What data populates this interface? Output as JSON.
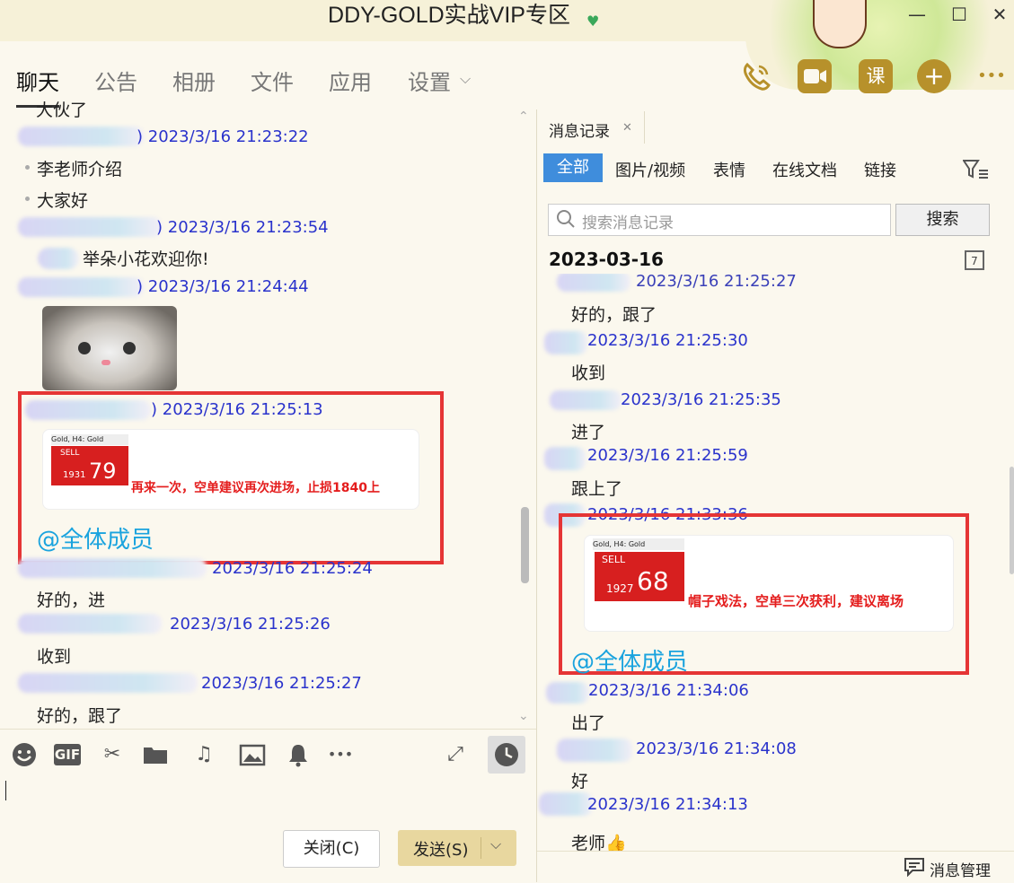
{
  "window": {
    "title": "DDY-GOLD实战VIP专区",
    "heart_glyph": "♥",
    "minimize_glyph": "—",
    "maximize_glyph": "☐",
    "close_glyph": "✕"
  },
  "nav": {
    "tabs": [
      "聊天",
      "公告",
      "相册",
      "文件",
      "应用",
      "设置"
    ],
    "settings_chevron": "⌵",
    "toolbar_icons": [
      "phone-icon",
      "video-icon",
      "course-icon",
      "add-icon",
      "more-icon"
    ],
    "course_label": "课",
    "add_label": "+",
    "more_label": "•••"
  },
  "chat": {
    "top_fragment": "大伙了",
    "messages": [
      {
        "time": "2023/3/16 21:23:22",
        "bullets": [
          "李老师介绍",
          "大家好"
        ]
      },
      {
        "time": "2023/3/16 21:23:54",
        "text": "举朵小花欢迎你!"
      },
      {
        "time": "2023/3/16 21:24:44",
        "image": "cat-sticker"
      },
      {
        "time": "2023/3/16 21:25:13",
        "card": {
          "symbol": "Gold, H4: Gold",
          "sell": "SELL",
          "price_small": "1931",
          "price_big": "79",
          "caption": "再来一次，空单建议再次进场，止损1840上"
        },
        "mention": "@全体成员"
      },
      {
        "time": "2023/3/16 21:25:24",
        "text": "好的，进"
      },
      {
        "time": "2023/3/16 21:25:26",
        "text": "收到"
      },
      {
        "time": "2023/3/16 21:25:27",
        "text": "好的，跟了"
      }
    ],
    "name_suffix": ")"
  },
  "input_toolbar": {
    "icons": [
      "emoji-icon",
      "gif-icon",
      "scissors-icon",
      "folder-icon",
      "music-icon",
      "image-icon",
      "bell-icon",
      "more-icon",
      "expand-icon",
      "history-icon"
    ],
    "gif_label": "GIF",
    "close_button": "关闭(C)",
    "send_button": "发送(S)",
    "send_dropdown": "⌵"
  },
  "history": {
    "tab_title": "消息记录",
    "tab_close": "✕",
    "filters": [
      "全部",
      "图片/视频",
      "表情",
      "在线文档",
      "链接"
    ],
    "search_placeholder": "搜索消息记录",
    "search_button": "搜索",
    "date": "2023-03-16",
    "calendar_day": "7",
    "messages": [
      {
        "time": "2023/3/16 21:25:27",
        "text": "好的，跟了"
      },
      {
        "time": "2023/3/16 21:25:30",
        "text": "收到"
      },
      {
        "time": "2023/3/16 21:25:35",
        "text": "进了"
      },
      {
        "time": "2023/3/16 21:25:59",
        "text": "跟上了"
      },
      {
        "time": "2023/3/16 21:33:36",
        "card": {
          "symbol": "Gold, H4: Gold",
          "sell": "SELL",
          "price_small": "1927",
          "price_big": "68",
          "caption": "帽子戏法，空单三次获利，建议离场"
        },
        "mention": "@全体成员"
      },
      {
        "time": "2023/3/16 21:34:06",
        "text": "出了"
      },
      {
        "time": "2023/3/16 21:34:08",
        "text": "好"
      },
      {
        "time": "2023/3/16 21:34:13",
        "text": "老师👍"
      }
    ],
    "manage_label": "消息管理"
  },
  "colors": {
    "background": "#fbf8ee",
    "timestamp": "#2a33cc",
    "highlight_box": "#e53535",
    "mention": "#1aa3de",
    "accent_tab": "#3f8ddc",
    "send_button": "#e8d79f"
  }
}
